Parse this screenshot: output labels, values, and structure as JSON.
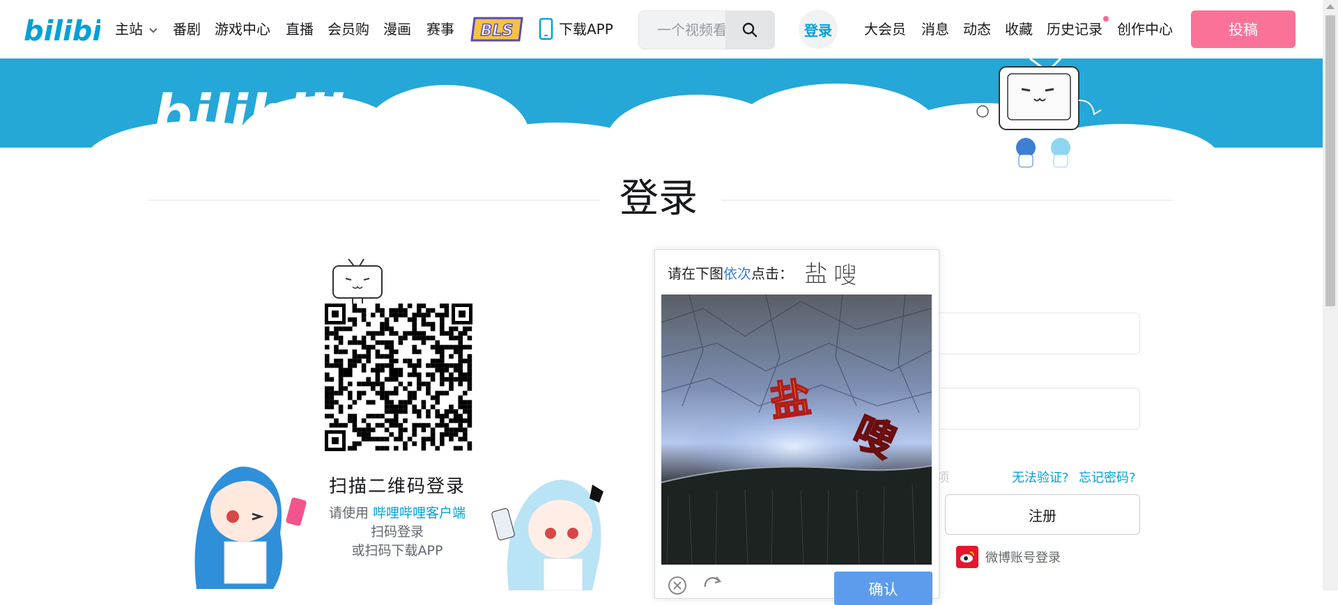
{
  "nav": {
    "logo_text": "bilibili",
    "items": [
      {
        "label": "主站"
      },
      {
        "label": "番剧"
      },
      {
        "label": "游戏中心"
      },
      {
        "label": "直播"
      },
      {
        "label": "会员购"
      },
      {
        "label": "漫画"
      },
      {
        "label": "赛事"
      }
    ],
    "event_badge": "BLS",
    "download_label": "下载APP",
    "search_placeholder": "一个视频看",
    "login_label": "登录",
    "right_items": [
      {
        "label": "大会员"
      },
      {
        "label": "消息"
      },
      {
        "label": "动态"
      },
      {
        "label": "收藏"
      },
      {
        "label": "历史记录"
      },
      {
        "label": "创作中心"
      }
    ],
    "upload_label": "投稿",
    "accent_color": "#00a1d6",
    "upload_color": "#fb7299"
  },
  "banner": {
    "logo_text": "bilibili",
    "color": "#25a7d8"
  },
  "page": {
    "title": "登录"
  },
  "qr": {
    "title": "扫描二维码登录",
    "line1_prefix": "请使用 ",
    "line1_link": "哔哩哔哩客户端",
    "line2": "扫码登录",
    "line3": "或扫码下载APP"
  },
  "form": {
    "remember_label": "项",
    "cannot_verify": "无法验证?",
    "forgot_password": "忘记密码?",
    "register_label": "注册",
    "weibo_login": "微博账号登录"
  },
  "captcha": {
    "prompt_prefix": "请在下图",
    "prompt_accent": "依次",
    "prompt_suffix": "点击：",
    "characters": [
      "盐",
      "嗖"
    ],
    "confirm_label": "确认",
    "accent_color": "#3b7ddd",
    "confirm_color": "#5d9cec"
  }
}
